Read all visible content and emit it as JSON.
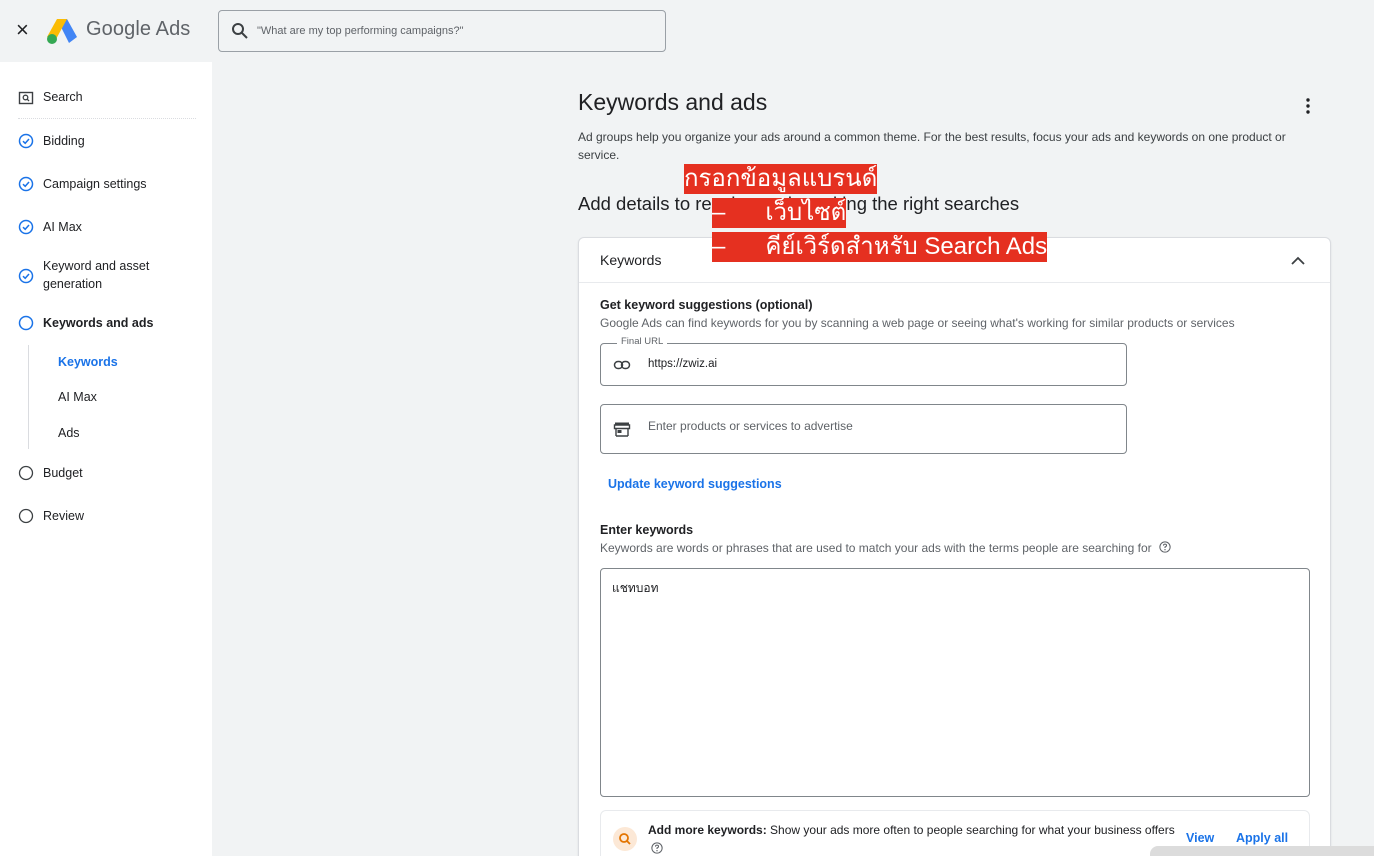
{
  "header": {
    "close_symbol": "×",
    "brand": "Google Ads",
    "search_placeholder": "\"What are my top performing campaigns?\""
  },
  "sidebar": {
    "items": [
      {
        "label": "Search",
        "icon": "search-box-icon"
      },
      {
        "label": "Bidding",
        "icon": "check-circle-icon"
      },
      {
        "label": "Campaign settings",
        "icon": "check-circle-icon"
      },
      {
        "label": "AI Max",
        "icon": "check-circle-icon"
      },
      {
        "label": "Keyword and asset",
        "label2": "generation",
        "icon": "check-circle-icon"
      },
      {
        "label": "Keywords and ads",
        "icon": "empty-circle-icon"
      },
      {
        "label": "Budget",
        "icon": "empty-circle-icon"
      },
      {
        "label": "Review",
        "icon": "empty-circle-icon"
      }
    ],
    "subitems": [
      {
        "label": "Keywords"
      },
      {
        "label": "AI Max"
      },
      {
        "label": "Ads"
      }
    ]
  },
  "main": {
    "title": "Keywords and ads",
    "description": "Ad groups help you organize your ads around a common theme. For the best results, focus your ads and keywords on one product or service.",
    "subheading": "Add details to reach people making the right searches",
    "card": {
      "title": "Keywords",
      "suggestions_title": "Get keyword suggestions (optional)",
      "suggestions_desc": "Google Ads can find keywords for you by scanning a web page or seeing what's working for similar products or services",
      "final_url_label": "Final URL",
      "final_url_value": "https://zwiz.ai",
      "products_placeholder": "Enter products or services to advertise",
      "update_link": "Update keyword suggestions",
      "enter_title": "Enter keywords",
      "enter_desc": "Keywords are words or phrases that are used to match your ads with the terms people are searching for",
      "keywords_value": "แชทบอท",
      "more_bold": "Add more keywords:",
      "more_text": " Show your ads more often to people searching for what your business offers",
      "view_link": "View",
      "apply_link": "Apply all"
    }
  },
  "overlay": {
    "line1": "กรอกข้อมูลแบรนด์",
    "line2": "–      เว็บไซต์",
    "line3": "–      คีย์เวิร์ดสำหรับ Search Ads",
    "color": "#e53020"
  },
  "colors": {
    "accent": "#1a73e8",
    "sidebar_bg": "#ffffff",
    "page_bg": "#f1f3f4"
  }
}
